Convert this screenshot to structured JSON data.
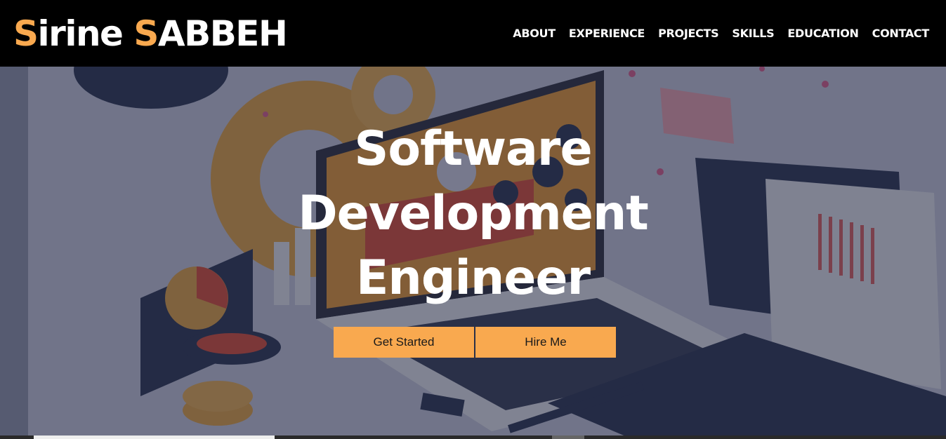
{
  "header": {
    "brand": {
      "first_initial": "S",
      "first_rest": "irine ",
      "last_initial": "S",
      "last_rest": "ABBEH"
    },
    "nav": [
      {
        "label": "ABOUT"
      },
      {
        "label": "EXPERIENCE"
      },
      {
        "label": "PROJECTS"
      },
      {
        "label": "SKILLS"
      },
      {
        "label": "EDUCATION"
      },
      {
        "label": "CONTACT"
      }
    ]
  },
  "hero": {
    "headline": [
      "Software",
      "Development",
      "Engineer"
    ],
    "buttons": {
      "primary": "Get Started",
      "secondary": "Hire Me"
    },
    "background_illustration": "isometric-laptop-workspace"
  },
  "colors": {
    "accent": "#f9a94f",
    "header_bg": "#000000",
    "text": "#ffffff",
    "hero_overlay": "#282c42"
  }
}
